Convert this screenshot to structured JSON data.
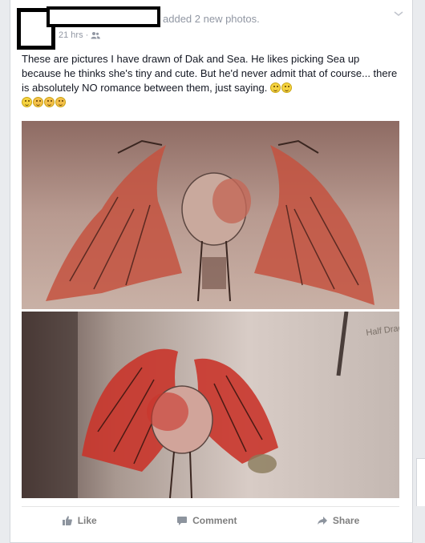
{
  "post": {
    "action_text": "added 2 new photos.",
    "timestamp": "21 hrs",
    "separator": "·",
    "audience_icon": "friends-icon",
    "text": "These are pictures I have drawn of Dak and Sea. He likes picking Sea up because he thinks she's tiny and cute. But he'd never admit that of course... there is absolutely NO romance between them, just saying.",
    "photos": [
      {
        "alt": "Drawing of winged character holding another character"
      },
      {
        "alt": "Second drawing with red wings and handwritten note"
      }
    ],
    "photo2_note": "Half Drag..."
  },
  "actions": {
    "like_label": "Like",
    "comment_label": "Comment",
    "share_label": "Share"
  },
  "colors": {
    "card_bg": "#ffffff",
    "page_bg": "#e9ebee",
    "meta_text": "#9197a3",
    "body_text": "#141823",
    "action_text": "#7f7f7f"
  }
}
